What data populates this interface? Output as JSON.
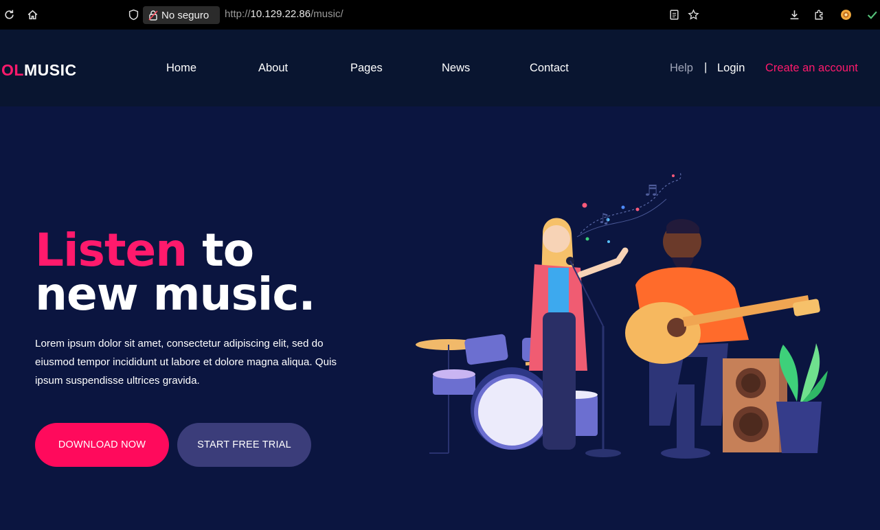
{
  "browser": {
    "security_label": "No seguro",
    "url_scheme": "http://",
    "url_host": "10.129.22.86",
    "url_path": "/music/"
  },
  "site": {
    "logo_accent": "OL",
    "logo_rest": "MUSIC",
    "nav": [
      "Home",
      "About",
      "Pages",
      "News",
      "Contact"
    ],
    "help": "Help",
    "separator": "|",
    "login": "Login",
    "create_account": "Create an account"
  },
  "hero": {
    "title_pink": "Listen",
    "title_white_1": " to",
    "title_white_2": "new music.",
    "text": "Lorem ipsum dolor sit amet, consectetur adipiscing elit, sed do eiusmod tempor incididunt ut labore et dolore magna aliqua. Quis ipsum suspendisse ultrices gravida.",
    "download_label": "DOWNLOAD NOW",
    "trial_label": "START FREE TRIAL"
  },
  "colors": {
    "accent": "#ff1a6c",
    "background": "#0b1540",
    "header": "#091530",
    "secondary_button": "#3b3d7a"
  }
}
